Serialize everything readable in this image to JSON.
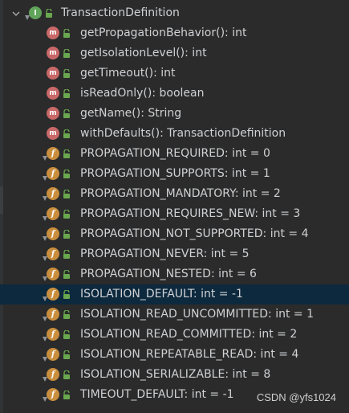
{
  "structure": {
    "root": {
      "label": "TransactionDefinition",
      "icon": "interface-icon",
      "expanded": true
    },
    "members": [
      {
        "kind": "method",
        "label": "getPropagationBehavior(): int"
      },
      {
        "kind": "method",
        "label": "getIsolationLevel(): int"
      },
      {
        "kind": "method",
        "label": "getTimeout(): int"
      },
      {
        "kind": "method",
        "label": "isReadOnly(): boolean"
      },
      {
        "kind": "method",
        "label": "getName(): String"
      },
      {
        "kind": "method",
        "label": "withDefaults(): TransactionDefinition"
      },
      {
        "kind": "field",
        "label": "PROPAGATION_REQUIRED: int = 0"
      },
      {
        "kind": "field",
        "label": "PROPAGATION_SUPPORTS: int = 1"
      },
      {
        "kind": "field",
        "label": "PROPAGATION_MANDATORY: int = 2"
      },
      {
        "kind": "field",
        "label": "PROPAGATION_REQUIRES_NEW: int = 3"
      },
      {
        "kind": "field",
        "label": "PROPAGATION_NOT_SUPPORTED: int = 4"
      },
      {
        "kind": "field",
        "label": "PROPAGATION_NEVER: int = 5"
      },
      {
        "kind": "field",
        "label": "PROPAGATION_NESTED: int = 6"
      },
      {
        "kind": "field",
        "label": "ISOLATION_DEFAULT: int = -1",
        "selected": true
      },
      {
        "kind": "field",
        "label": "ISOLATION_READ_UNCOMMITTED: int = 1"
      },
      {
        "kind": "field",
        "label": "ISOLATION_READ_COMMITTED: int = 2"
      },
      {
        "kind": "field",
        "label": "ISOLATION_REPEATABLE_READ: int = 4"
      },
      {
        "kind": "field",
        "label": "ISOLATION_SERIALIZABLE: int = 8"
      },
      {
        "kind": "field",
        "label": "TIMEOUT_DEFAULT: int = -1"
      }
    ]
  },
  "icons": {
    "interface_letter": "I",
    "method_letter": "m",
    "field_letter": "f"
  },
  "colors": {
    "background": "#2b2b2b",
    "selection": "#0d293e",
    "interface_icon": "#60a45a",
    "method_icon": "#c86868",
    "field_icon": "#c98e3d",
    "lock_icon": "#6aa84f",
    "text": "#cfd1d4"
  },
  "watermark": "CSDN @yfs1024"
}
